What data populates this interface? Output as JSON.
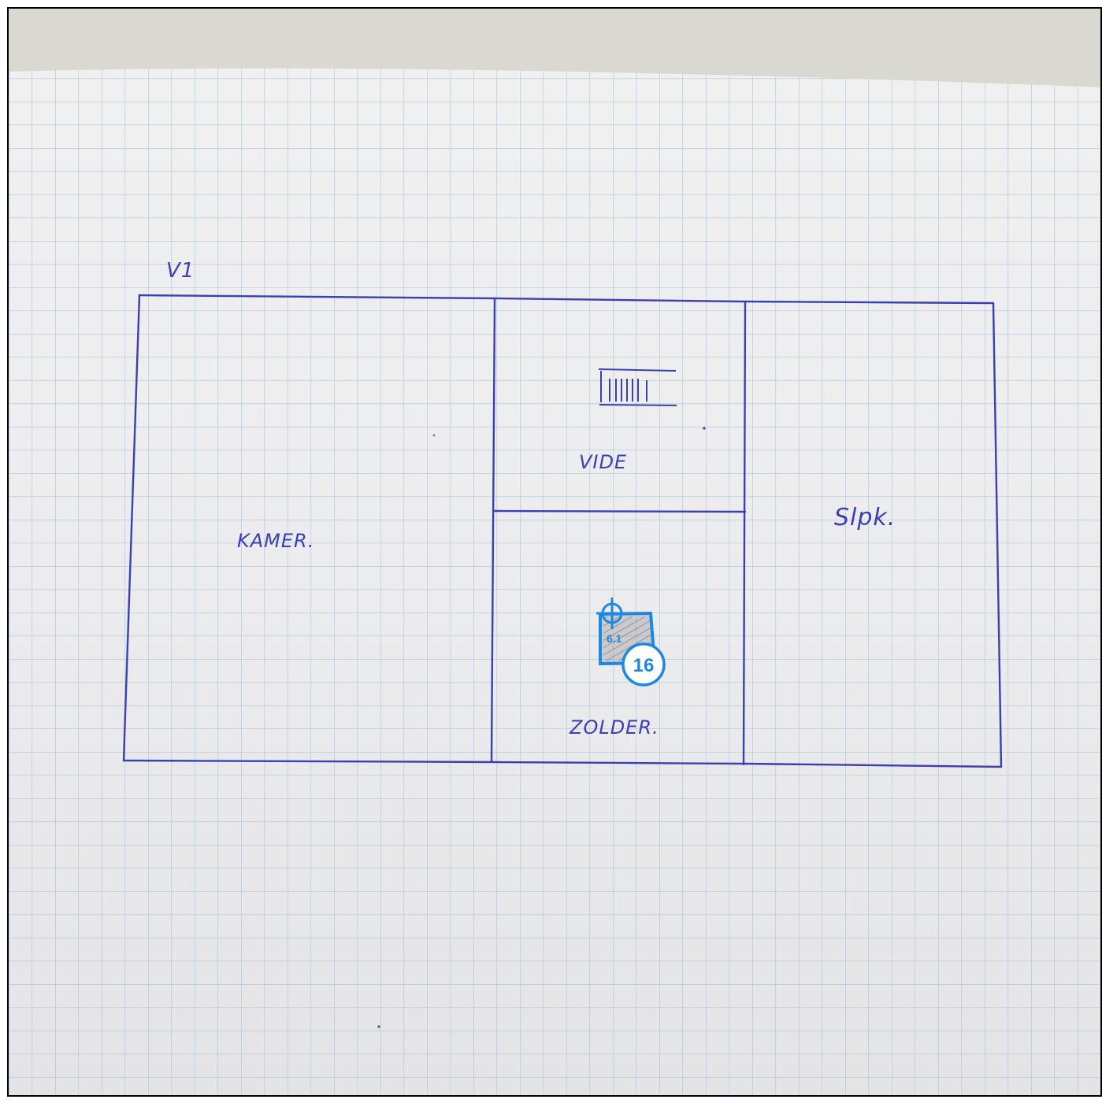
{
  "plan": {
    "level_label": "V1",
    "rooms": {
      "kamer": "KAMER.",
      "vide": "VIDE",
      "slpk": "Slpk.",
      "zolder": "ZOLDER."
    }
  },
  "marker": {
    "number": "16",
    "inner_label": "6.1",
    "color": "#1e87e0"
  },
  "colors": {
    "ink": "#3c3fb0",
    "grid": "#a8c6d6",
    "paper": "#ebebec",
    "background": "#d9d9d2"
  }
}
